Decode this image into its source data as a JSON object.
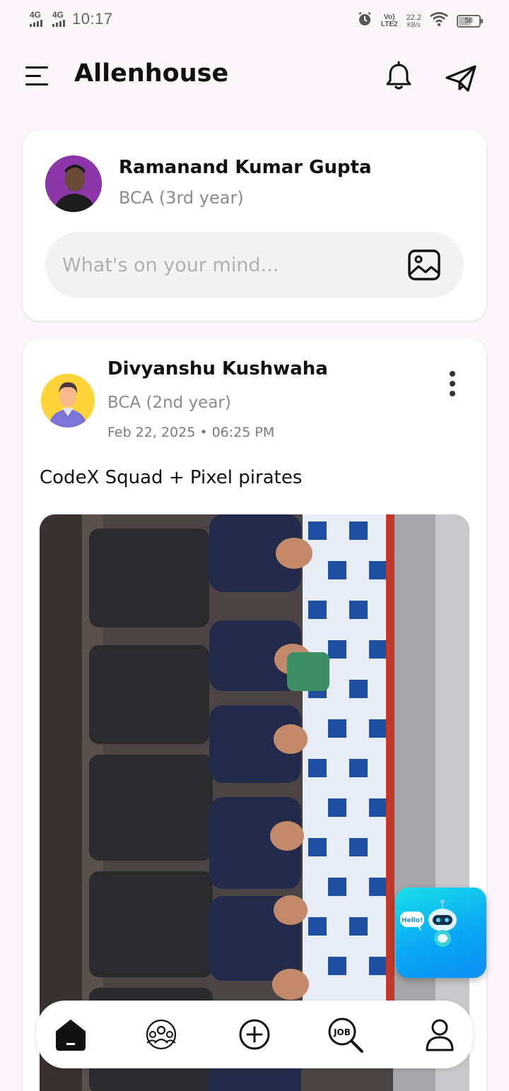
{
  "status_bar": {
    "network1": "4G",
    "network2": "4G",
    "time": "10:17",
    "volte_line1": "Vo)",
    "volte_line2": "LTE2",
    "speed_value": "22.2",
    "speed_unit": "KB/s",
    "battery": "58",
    "icons": [
      "alarm-icon",
      "wifi-icon",
      "battery-icon"
    ]
  },
  "header": {
    "title": "Allenhouse",
    "icons": [
      "menu-icon",
      "bell-icon",
      "send-icon"
    ]
  },
  "composer": {
    "user_name": "Ramanand Kumar Gupta",
    "user_course": "BCA (3rd year)",
    "placeholder": "What's on your mind...",
    "icons": [
      "image-icon"
    ]
  },
  "post": {
    "author_name": "Divyanshu Kushwaha",
    "author_course": "BCA (2nd year)",
    "timestamp": "Feb 22, 2025 • 06:25 PM",
    "caption": "CodeX Squad + Pixel pirates",
    "icons": [
      "more-vertical-icon"
    ]
  },
  "chatbot": {
    "bubble_text": "Hello!"
  },
  "bottom_nav": {
    "items": [
      {
        "name": "home",
        "icon": "home-icon",
        "active": true
      },
      {
        "name": "community",
        "icon": "community-icon",
        "active": false
      },
      {
        "name": "create",
        "icon": "add-circle-icon",
        "active": false
      },
      {
        "name": "jobs",
        "icon": "job-search-icon",
        "active": false
      },
      {
        "name": "profile",
        "icon": "profile-icon",
        "active": false
      }
    ],
    "job_icon_text": "JOB"
  },
  "colors": {
    "background": "#fcf6fb",
    "card": "#ffffff",
    "chatbot_gradient_start": "#19e0e8",
    "chatbot_gradient_end": "#0b8ff5"
  }
}
